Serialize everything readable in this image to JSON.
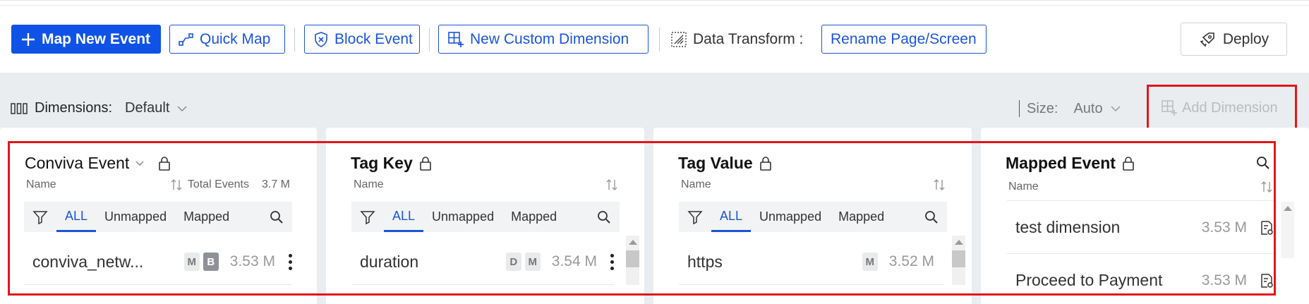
{
  "toolbar": {
    "map_new_event": "Map New Event",
    "quick_map": "Quick Map",
    "block_event": "Block Event",
    "new_custom_dimension": "New Custom Dimension",
    "data_transform_label": "Data Transform :",
    "rename_page_screen": "Rename Page/Screen",
    "deploy": "Deploy"
  },
  "dimbar": {
    "dimensions_label": "Dimensions:",
    "dimensions_value": "Default",
    "size_label": "Size:",
    "size_value": "Auto",
    "add_dimension": "Add Dimension"
  },
  "cards": {
    "conviva": {
      "title": "Conviva Event",
      "name_col": "Name",
      "total_label": "Total Events",
      "total_value": "3.7 M",
      "tabs": [
        "ALL",
        "Unmapped",
        "Mapped"
      ],
      "row": {
        "name": "conviva_netw...",
        "badges": [
          "M",
          "B"
        ],
        "count": "3.53 M"
      }
    },
    "tagkey": {
      "title": "Tag Key",
      "name_col": "Name",
      "tabs": [
        "ALL",
        "Unmapped",
        "Mapped"
      ],
      "row": {
        "name": "duration",
        "badges": [
          "D",
          "M"
        ],
        "count": "3.54 M"
      }
    },
    "tagvalue": {
      "title": "Tag Value",
      "name_col": "Name",
      "tabs": [
        "ALL",
        "Unmapped",
        "Mapped"
      ],
      "row": {
        "name": "https",
        "badges": [
          "M"
        ],
        "count": "3.52 M"
      }
    },
    "mapped": {
      "title": "Mapped Event",
      "name_col": "Name",
      "rows": [
        {
          "name": "test dimension",
          "count": "3.53 M"
        },
        {
          "name": "Proceed to Payment",
          "count": "3.53 M"
        }
      ]
    }
  },
  "colors": {
    "primary": "#0f53e6",
    "highlight": "#e1161c"
  }
}
